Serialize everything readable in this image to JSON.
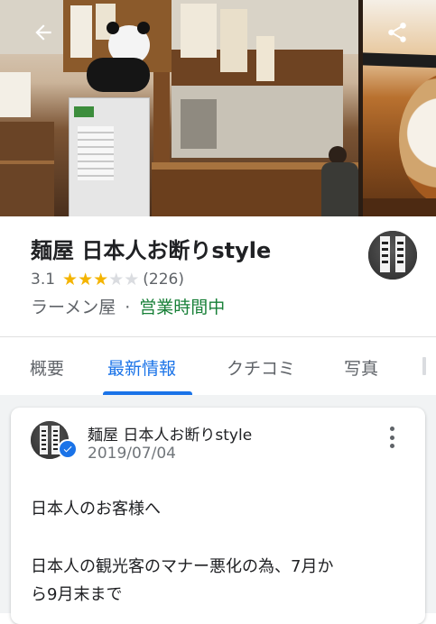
{
  "header": {
    "back_icon": "arrow-back-icon",
    "share_icon": "share-icon"
  },
  "place": {
    "name": "麺屋 日本人お断りstyle",
    "rating": "3.1",
    "stars_filled": 3,
    "reviews_count": "(226)",
    "category": "ラーメン屋",
    "separator": "·",
    "status": "営業時間中",
    "status_color": "#188038"
  },
  "tabs": [
    {
      "label": "概要",
      "active": false
    },
    {
      "label": "最新情報",
      "active": true
    },
    {
      "label": "クチコミ",
      "active": false
    },
    {
      "label": "写真",
      "active": false
    }
  ],
  "post": {
    "author": "麺屋 日本人お断りstyle",
    "date": "2019/07/04",
    "line1": "日本人のお客様へ",
    "line2": "日本人の観光客のマナー悪化の為、7月か",
    "line3": "ら9月末まで"
  },
  "colors": {
    "accent": "#1a73e8",
    "star": "#f4b400"
  }
}
